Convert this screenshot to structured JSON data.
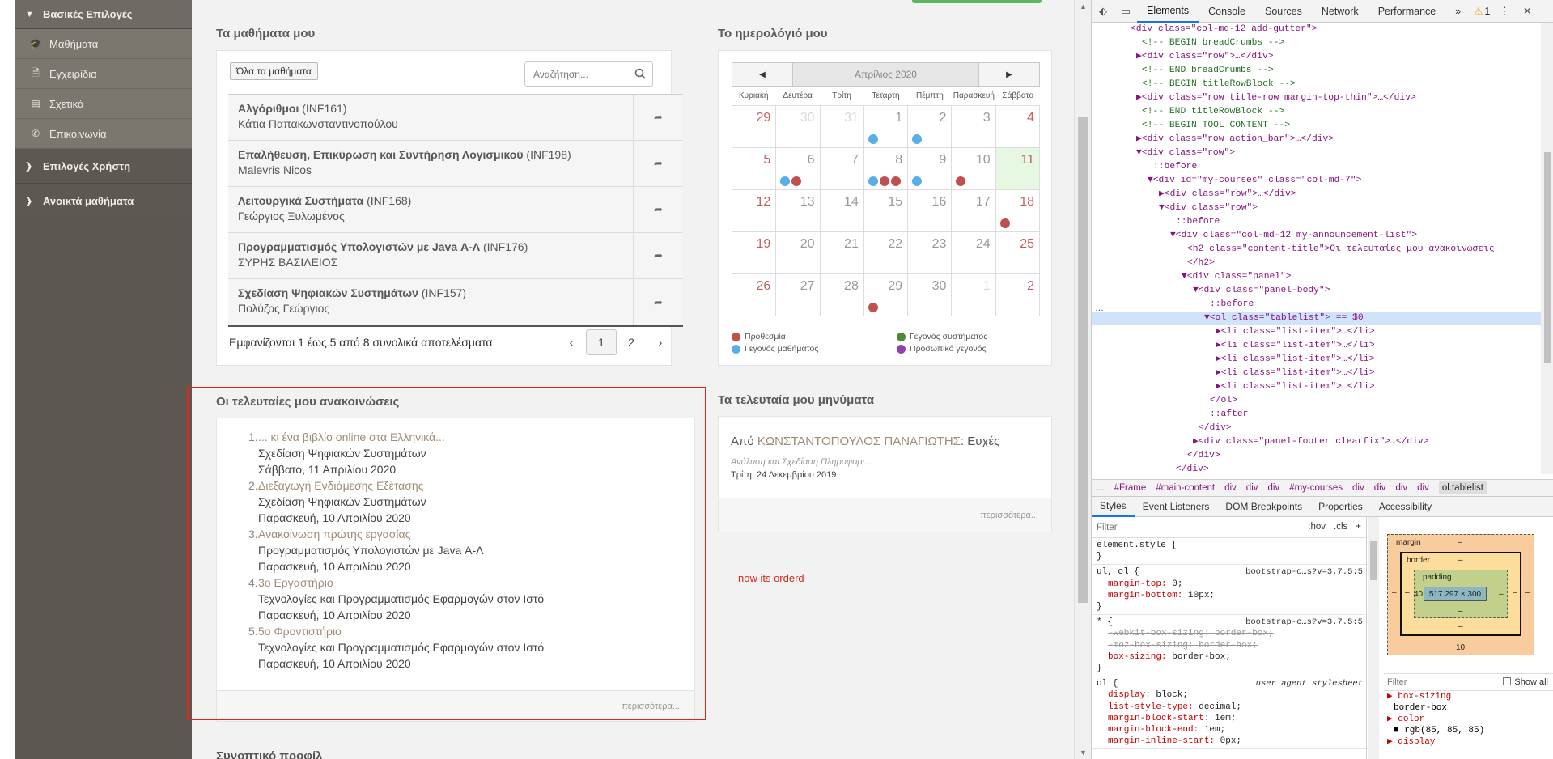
{
  "sidebar": {
    "basic_header": "Βασικές Επιλογές",
    "items": [
      {
        "label": "Μαθήματα",
        "icon": "graduation-cap-icon"
      },
      {
        "label": "Εγχειρίδια",
        "icon": "document-icon"
      },
      {
        "label": "Σχετικά",
        "icon": "card-icon"
      },
      {
        "label": "Επικοινωνία",
        "icon": "phone-icon"
      }
    ],
    "groups": [
      {
        "label": "Επιλογές Χρήστη"
      },
      {
        "label": "Ανοικτά μαθήματα"
      }
    ]
  },
  "courses": {
    "title": "Τα μαθήματα μου",
    "all_button": "Όλα τα μαθήματα",
    "search_placeholder": "Αναζήτηση...",
    "rows": [
      {
        "name": "Αλγόριθμοι",
        "code": "(INF161)",
        "professor": "Κάτια Παπακωνσταντινοπούλου"
      },
      {
        "name": "Επαλήθευση, Επικύρωση και Συντήρηση Λογισμικού",
        "code": "(INF198)",
        "professor": "Malevris Nicos"
      },
      {
        "name": "Λειτουργικά Συστήματα",
        "code": "(INF168)",
        "professor": "Γεώργιος Ξυλωμένος"
      },
      {
        "name": "Προγραμματισμός Υπολογιστών με Java Α-Λ",
        "code": "(INF176)",
        "professor": "ΣΥΡΗΣ ΒΑΣΙΛΕΙΟΣ"
      },
      {
        "name": "Σχεδίαση Ψηφιακών Συστημάτων",
        "code": "(INF157)",
        "professor": "Πολύζος Γεώργιος"
      }
    ],
    "footer": "Εμφανίζονται 1 έως 5 από 8 συνολικά αποτελέσματα",
    "pager": {
      "prev": "‹",
      "pages": [
        "1",
        "2"
      ],
      "next": "›"
    }
  },
  "calendar": {
    "title": "Το ημερολόγιό μου",
    "prev": "◀",
    "next": "▶",
    "month": "Απρίλιος 2020",
    "weekdays": [
      "Κυριακή",
      "Δευτέρα",
      "Τρίτη",
      "Τετάρτη",
      "Πέμπτη",
      "Παρασκευή",
      "Σάββατο"
    ],
    "weeks": [
      [
        {
          "d": "29",
          "other": true
        },
        {
          "d": "30",
          "other": true
        },
        {
          "d": "31",
          "other": true
        },
        {
          "d": "1",
          "dots": [
            "blue"
          ]
        },
        {
          "d": "2",
          "dots": [
            "blue"
          ]
        },
        {
          "d": "3"
        },
        {
          "d": "4"
        }
      ],
      [
        {
          "d": "5"
        },
        {
          "d": "6",
          "dots": [
            "blue",
            "red"
          ]
        },
        {
          "d": "7"
        },
        {
          "d": "8",
          "dots": [
            "blue",
            "red",
            "red"
          ]
        },
        {
          "d": "9",
          "dots": [
            "blue"
          ]
        },
        {
          "d": "10",
          "dots": [
            "red"
          ]
        },
        {
          "d": "11",
          "today": true
        }
      ],
      [
        {
          "d": "12"
        },
        {
          "d": "13"
        },
        {
          "d": "14"
        },
        {
          "d": "15"
        },
        {
          "d": "16"
        },
        {
          "d": "17"
        },
        {
          "d": "18",
          "dots": [
            "red"
          ]
        }
      ],
      [
        {
          "d": "19"
        },
        {
          "d": "20"
        },
        {
          "d": "21"
        },
        {
          "d": "22"
        },
        {
          "d": "23"
        },
        {
          "d": "24"
        },
        {
          "d": "25"
        }
      ],
      [
        {
          "d": "26"
        },
        {
          "d": "27"
        },
        {
          "d": "28"
        },
        {
          "d": "29",
          "dots": [
            "red"
          ]
        },
        {
          "d": "30"
        },
        {
          "d": "1",
          "other": true
        },
        {
          "d": "2",
          "other": true
        }
      ]
    ],
    "legend": [
      {
        "label": "Προθεσμία",
        "color": "#c0504d"
      },
      {
        "label": "Γεγονός συστήματος",
        "color": "#4e8a3a"
      },
      {
        "label": "Γεγονός μαθήματος",
        "color": "#5aaee8"
      },
      {
        "label": "Προσωπικό γεγονός",
        "color": "#8e44ad"
      }
    ],
    "dot_colors": {
      "red": "#c0504d",
      "blue": "#5aaee8"
    }
  },
  "announcements": {
    "title": "Οι τελευταίες μου ανακοινώσεις",
    "items": [
      {
        "num": "1.",
        "title": "... κι ένα βιβλίο online στα Ελληνικά...",
        "course": "Σχεδίαση Ψηφιακών Συστημάτων",
        "date": "Σάββατο, 11 Απριλίου 2020"
      },
      {
        "num": "2.",
        "title": "Διεξαγωγή Ενδιάμεσης Εξέτασης",
        "course": "Σχεδίαση Ψηφιακών Συστημάτων",
        "date": "Παρασκευή, 10 Απριλίου 2020"
      },
      {
        "num": "3.",
        "title": "Ανακοίνωση πρώτης εργασίας",
        "course": "Προγραμματισμός Υπολογιστών με Java Α-Λ",
        "date": "Παρασκευή, 10 Απριλίου 2020"
      },
      {
        "num": "4.",
        "title": "3ο Εργαστήριο",
        "course": "Τεχνολογίες και Προγραμματισμός Εφαρμογών στον Ιστό",
        "date": "Παρασκευή, 10 Απριλίου 2020"
      },
      {
        "num": "5.",
        "title": "5ο Φροντιστήριο",
        "course": "Τεχνολογίες και Προγραμματισμός Εφαρμογών στον Ιστό",
        "date": "Παρασκευή, 10 Απριλίου 2020"
      }
    ],
    "more": "περισσότερα..."
  },
  "messages": {
    "title": "Τα τελευταία μου μηνύματα",
    "from_label": "Από",
    "sender": "ΚΩΝΣΤΑΝΤΟΠΟΥΛΟΣ ΠΑΝΑΓΙΩΤΗΣ",
    "subject": ": Ευχές",
    "course": "Ανάλυση και Σχεδίαση Πληροφορι...",
    "date": "Τρίτη, 24 Δεκεμβρίου 2019",
    "more": "περισσότερα..."
  },
  "note": "now its orderd",
  "summary_title": "Συνοπτικό προφίλ",
  "devtools": {
    "tabs": [
      "Elements",
      "Console",
      "Sources",
      "Network",
      "Performance"
    ],
    "more_tabs": "»",
    "warning_count": "1",
    "dom_lines": [
      {
        "t": "tag",
        "text": "<div class=\"col-md-12 add-gutter\">",
        "indent": 6
      },
      {
        "t": "cmt",
        "text": "<!-- BEGIN breadCrumbs -->",
        "indent": 8
      },
      {
        "t": "tag",
        "text": "▶<div class=\"row\">…</div>",
        "indent": 7
      },
      {
        "t": "cmt",
        "text": "<!-- END breadCrumbs -->",
        "indent": 8
      },
      {
        "t": "cmt",
        "text": "<!-- BEGIN titleRowBlock -->",
        "indent": 8
      },
      {
        "t": "tag",
        "text": "▶<div class=\"row title-row margin-top-thin\">…</div>",
        "indent": 7
      },
      {
        "t": "cmt",
        "text": "<!-- END titleRowBlock -->",
        "indent": 8
      },
      {
        "t": "cmt",
        "text": "<!-- BEGIN TOOL CONTENT -->",
        "indent": 8
      },
      {
        "t": "tag",
        "text": "▶<div class=\"row action_bar\">…</div>",
        "indent": 7
      },
      {
        "t": "tag",
        "text": "▼<div class=\"row\">",
        "indent": 7
      },
      {
        "t": "pseudo",
        "text": "::before",
        "indent": 10
      },
      {
        "t": "tag",
        "text": "▼<div id=\"my-courses\" class=\"col-md-7\">",
        "indent": 9
      },
      {
        "t": "tag",
        "text": "▶<div class=\"row\">…</div>",
        "indent": 11
      },
      {
        "t": "tag",
        "text": "▼<div class=\"row\">",
        "indent": 11
      },
      {
        "t": "pseudo",
        "text": "::before",
        "indent": 14
      },
      {
        "t": "tag",
        "text": "▼<div class=\"col-md-12 my-announcement-list\">",
        "indent": 13
      },
      {
        "t": "tag",
        "text": "<h2 class=\"content-title\">Οι τελευταίες μου ανακοινώσεις",
        "indent": 16
      },
      {
        "t": "tag",
        "text": "</h2>",
        "indent": 16
      },
      {
        "t": "tag",
        "text": "▼<div class=\"panel\">",
        "indent": 15
      },
      {
        "t": "tag",
        "text": "▼<div class=\"panel-body\">",
        "indent": 17
      },
      {
        "t": "pseudo",
        "text": "::before",
        "indent": 20
      },
      {
        "t": "tag",
        "text": "▼<ol class=\"tablelist\"> == $0",
        "indent": 19,
        "sel": true
      },
      {
        "t": "tag",
        "text": "▶<li class=\"list-item\">…</li>",
        "indent": 21
      },
      {
        "t": "tag",
        "text": "▶<li class=\"list-item\">…</li>",
        "indent": 21
      },
      {
        "t": "tag",
        "text": "▶<li class=\"list-item\">…</li>",
        "indent": 21
      },
      {
        "t": "tag",
        "text": "▶<li class=\"list-item\">…</li>",
        "indent": 21
      },
      {
        "t": "tag",
        "text": "▶<li class=\"list-item\">…</li>",
        "indent": 21
      },
      {
        "t": "tag",
        "text": "</ol>",
        "indent": 20
      },
      {
        "t": "pseudo",
        "text": "::after",
        "indent": 20
      },
      {
        "t": "tag",
        "text": "</div>",
        "indent": 18
      },
      {
        "t": "tag",
        "text": "▶<div class=\"panel-footer clearfix\">…</div>",
        "indent": 17
      },
      {
        "t": "tag",
        "text": "</div>",
        "indent": 16
      },
      {
        "t": "tag",
        "text": "</div>",
        "indent": 14
      },
      {
        "t": "pseudo",
        "text": "::after",
        "indent": 14
      }
    ],
    "dom_gutter": "…",
    "breadcrumbs": [
      "...",
      "#Frame",
      "#main-content",
      "div",
      "div",
      "div",
      "#my-courses",
      "div",
      "div",
      "div",
      "div",
      "ol.tablelist"
    ],
    "sub_tabs": [
      "Styles",
      "Event Listeners",
      "DOM Breakpoints",
      "Properties",
      "Accessibility"
    ],
    "filter_placeholder": "Filter",
    "hov": ":hov",
    "cls": ".cls",
    "plus": "+",
    "rules": [
      {
        "selector": "element.style {",
        "src": "",
        "props": [],
        "close": "}"
      },
      {
        "selector": "ul, ol {",
        "src": "bootstrap-c…s?v=3.7.5:5",
        "props": [
          {
            "n": "margin-top",
            "v": "0;"
          },
          {
            "n": "margin-bottom",
            "v": "10px;"
          }
        ],
        "close": "}"
      },
      {
        "selector": "* {",
        "src": "bootstrap-c…s?v=3.7.5:5",
        "props": [
          {
            "n": "-webkit-box-sizing",
            "v": "border-box;",
            "strike": true
          },
          {
            "n": "-moz-box-sizing",
            "v": "border-box;",
            "strike": true
          },
          {
            "n": "box-sizing",
            "v": "border-box;"
          }
        ],
        "close": "}"
      },
      {
        "selector": "ol {",
        "src": "user agent stylesheet",
        "ua": true,
        "props": [
          {
            "n": "display",
            "v": "block;"
          },
          {
            "n": "list-style-type",
            "v": "decimal;"
          },
          {
            "n": "margin-block-start",
            "v": "1em;"
          },
          {
            "n": "margin-block-end",
            "v": "1em;"
          },
          {
            "n": "margin-inline-start",
            "v": "0px;"
          }
        ],
        "close": ""
      }
    ],
    "box_model": {
      "margin_label": "margin",
      "margin_top": "–",
      "margin_bottom": "10",
      "margin_left": "–",
      "margin_right": "–",
      "border_label": "border",
      "border_val": "–",
      "border_bottom": "–",
      "border_left": "–",
      "border_right": "–",
      "padding_label": "padding",
      "padding_top": "–",
      "padding_bottom": "–",
      "padding_left": "40",
      "padding_right": "–",
      "content": "517.297 × 300"
    },
    "computed": {
      "filter_placeholder": "Filter",
      "show_all": "Show all",
      "props": [
        {
          "n": "box-sizing",
          "v": "border-box"
        },
        {
          "n": "color",
          "v": "rgb(85, 85, 85)"
        },
        {
          "n": "display",
          "v": ""
        }
      ]
    }
  }
}
